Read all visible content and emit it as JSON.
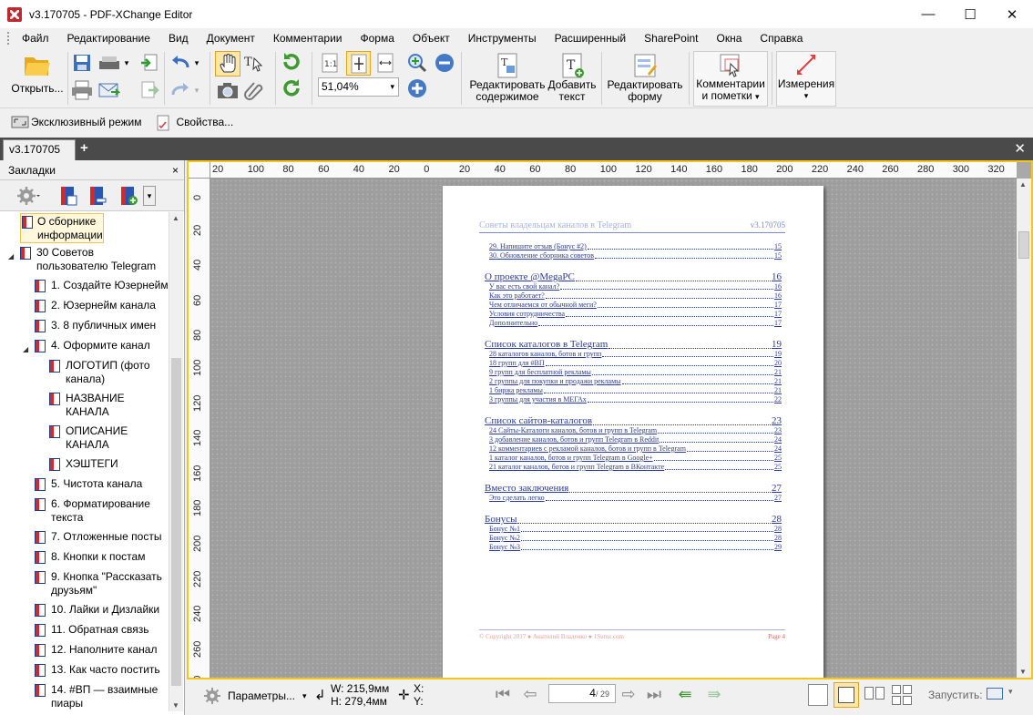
{
  "window": {
    "title": "v3.170705 - PDF-XChange Editor",
    "controls": {
      "minimize": "—",
      "maximize": "☐",
      "close": "✕"
    }
  },
  "menu": [
    "Файл",
    "Редактирование",
    "Вид",
    "Документ",
    "Комментарии",
    "Форма",
    "Объект",
    "Инструменты",
    "Расширенный",
    "SharePoint",
    "Окна",
    "Справка"
  ],
  "toolbar": {
    "open_label": "Открыть...",
    "zoom_value": "51,04%",
    "edit_content_label_1": "Редактировать",
    "edit_content_label_2": "содержимое",
    "add_text_label_1": "Добавить",
    "add_text_label_2": "текст",
    "edit_form_label_1": "Редактировать",
    "edit_form_label_2": "форму",
    "comments_label_1": "Комментарии",
    "comments_label_2": "и пометки",
    "measure_label": "Измерения",
    "dropdown_glyph": "▾"
  },
  "toolbar2": {
    "exclusive_mode": "Эксклюзивный режим",
    "properties": "Свойства..."
  },
  "tabs": {
    "active": "v3.170705",
    "plus": "+",
    "close": "✕"
  },
  "sidebar": {
    "title": "Закладки",
    "close": "×",
    "items": [
      {
        "label1": "О сборнике",
        "label2": "информации"
      },
      {
        "label1": "30 Советов",
        "label2": "пользователю Telegram"
      },
      {
        "label1": "1. Создайте Юзернейм",
        "label2": ""
      },
      {
        "label1": "2. Юзернейм канала",
        "label2": ""
      },
      {
        "label1": "3. 8 публичных имен",
        "label2": ""
      },
      {
        "label1": "4. Оформите канал",
        "label2": ""
      },
      {
        "label1": "ЛОГОТИП (фото",
        "label2": "канала)"
      },
      {
        "label1": "НАЗВАНИЕ",
        "label2": "КАНАЛА"
      },
      {
        "label1": "ОПИСАНИЕ",
        "label2": "КАНАЛА"
      },
      {
        "label1": "ХЭШТЕГИ",
        "label2": ""
      },
      {
        "label1": "5. Чистота канала",
        "label2": ""
      },
      {
        "label1": "6. Форматирование",
        "label2": "текста"
      },
      {
        "label1": "7. Отложенные посты",
        "label2": ""
      },
      {
        "label1": "8. Кнопки к постам",
        "label2": ""
      },
      {
        "label1": "9. Кнопка \"Рассказать",
        "label2": "друзьям\""
      },
      {
        "label1": "10. Лайки и Дизлайки",
        "label2": ""
      },
      {
        "label1": "11. Обратная связь",
        "label2": ""
      },
      {
        "label1": "12. Наполните канал",
        "label2": ""
      },
      {
        "label1": "13. Как часто постить",
        "label2": ""
      },
      {
        "label1": "14. #ВП — взаимные",
        "label2": "пиары"
      }
    ]
  },
  "rulers": {
    "h_labels": [
      "20",
      "100",
      "80",
      "60",
      "40",
      "20",
      "0",
      "20",
      "40",
      "60",
      "80",
      "100",
      "120",
      "140",
      "160",
      "180",
      "200",
      "220",
      "240",
      "260",
      "280",
      "300",
      "320"
    ],
    "v_labels": [
      "0",
      "20",
      "40",
      "60",
      "80",
      "100",
      "120",
      "140",
      "160",
      "180",
      "200",
      "220",
      "240",
      "260",
      "280"
    ]
  },
  "page": {
    "header_left": "Советы владельцам каналов в Telegram",
    "header_right": "v3.170705",
    "toc": [
      {
        "kind": "sub",
        "text": "29. Напишите отзыв (Бонус #2)",
        "page": "15"
      },
      {
        "kind": "sub",
        "text": "30. Обновление сборника советов",
        "page": "15"
      },
      {
        "kind": "sec",
        "text": "О проекте @MegaPC",
        "page": "16"
      },
      {
        "kind": "sub",
        "text": "У вас есть свой канал?",
        "page": "16"
      },
      {
        "kind": "sub",
        "text": "Как это работает?",
        "page": "16"
      },
      {
        "kind": "sub",
        "text": "Чем отличаемся от обычной меги?",
        "page": "17"
      },
      {
        "kind": "sub",
        "text": "Условия сотрудничества",
        "page": "17"
      },
      {
        "kind": "sub",
        "text": "Дополнительно",
        "page": "17"
      },
      {
        "kind": "sec",
        "text": "Список каталогов в Telegram",
        "page": "19"
      },
      {
        "kind": "sub",
        "text": "28 каталогов каналов, ботов и групп",
        "page": "19"
      },
      {
        "kind": "sub",
        "text": "18 групп для #ВП",
        "page": "20"
      },
      {
        "kind": "sub",
        "text": "9 групп для бесплатной рекламы",
        "page": "21"
      },
      {
        "kind": "sub",
        "text": "2 группы для покупки и продажи рекламы",
        "page": "21"
      },
      {
        "kind": "sub",
        "text": "1 биржа рекламы",
        "page": "21"
      },
      {
        "kind": "sub",
        "text": "3 группы для участия в МЕГАх",
        "page": "22"
      },
      {
        "kind": "sec",
        "text": "Список сайтов-каталогов",
        "page": "23"
      },
      {
        "kind": "sub",
        "text": "24 Сайты-Каталоги каналов, ботов и групп в Telegram",
        "page": "23"
      },
      {
        "kind": "sub",
        "text": "3 добавление каналов, ботов и групп Telegram в Reddit",
        "page": "24"
      },
      {
        "kind": "sub",
        "text": "12 комментариев с рекламой каналов, ботов и групп в Telegram",
        "page": "24"
      },
      {
        "kind": "sub",
        "text": "1 каталог каналов, ботов и групп Telegram в Google+",
        "page": "25"
      },
      {
        "kind": "sub",
        "text": "21 каталог каналов, ботов и групп Telegram в ВКонтакте",
        "page": "25"
      },
      {
        "kind": "sec",
        "text": "Вместо заключения",
        "page": "27"
      },
      {
        "kind": "sub",
        "text": "Это сделать легко",
        "page": "27"
      },
      {
        "kind": "sec",
        "text": "Бонусы",
        "page": "28"
      },
      {
        "kind": "sub",
        "text": "Бонус №1",
        "page": "28"
      },
      {
        "kind": "sub",
        "text": "Бонус №2",
        "page": "28"
      },
      {
        "kind": "sub",
        "text": "Бонус №3",
        "page": "29"
      }
    ],
    "footer_left": "© Copyright 2017 ● Анатолий Владенко ● 1Sumz.com",
    "footer_right": "Page 4"
  },
  "status": {
    "params_label": "Параметры...",
    "width": "W: 215,9мм",
    "height": "H: 279,4мм",
    "x_label": "X:",
    "y_label": "Y:",
    "page_current": "4",
    "page_total": "/ 29",
    "run_label": "Запустить:"
  },
  "colors": {
    "accent": "#f5c518",
    "tabbar": "#4a4a4a",
    "bookmark_red": "#d62828",
    "toc_blue": "#2a3aa0"
  }
}
